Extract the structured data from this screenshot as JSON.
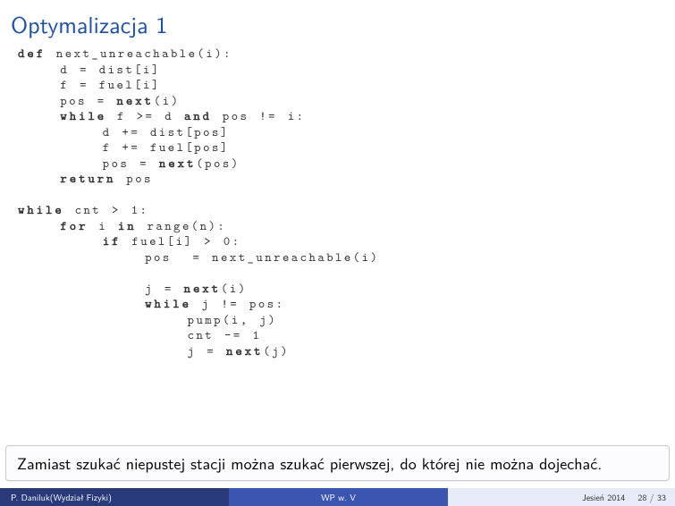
{
  "title": "Optymalizacja 1",
  "code_lines": [
    {
      "cls": "kw",
      "text": "def",
      "rest": " next_unreachable(i):"
    },
    {
      "cls": "",
      "text": "    d = dist[i]"
    },
    {
      "cls": "",
      "text": "    f = fuel[i]"
    },
    {
      "cls": "",
      "text": "    pos = ",
      "kw": "next",
      "rest2": "(i)"
    },
    {
      "cls": "",
      "pre": "    ",
      "kw": "while",
      "mid": " f >= d ",
      "kw2": "and",
      "rest": " pos != i:"
    },
    {
      "cls": "",
      "text": "        d += dist[pos]"
    },
    {
      "cls": "",
      "text": "        f += fuel[pos]"
    },
    {
      "cls": "",
      "text": "        pos = ",
      "kw": "next",
      "rest2": "(pos)"
    },
    {
      "cls": "",
      "pre": "    ",
      "kw": "return",
      "rest": " pos"
    },
    {
      "cls": "",
      "text": ""
    },
    {
      "cls": "kw",
      "text": "while",
      "rest": " cnt > 1:"
    },
    {
      "cls": "",
      "pre": "    ",
      "kw": "for",
      "mid": " i ",
      "kw2": "in",
      "rest": " range(n):"
    },
    {
      "cls": "",
      "pre": "        ",
      "kw": "if",
      "rest": " fuel[i] > 0:"
    },
    {
      "cls": "",
      "text": "            pos  = next_unreachable(i)"
    },
    {
      "cls": "",
      "text": ""
    },
    {
      "cls": "",
      "text": "            j = ",
      "kw": "next",
      "rest2": "(i)"
    },
    {
      "cls": "",
      "pre": "            ",
      "kw": "while",
      "rest": " j != pos:"
    },
    {
      "cls": "",
      "text": "                pump(i, j)"
    },
    {
      "cls": "",
      "text": "                cnt -= 1"
    },
    {
      "cls": "",
      "text": "                j = ",
      "kw": "next",
      "rest2": "(j)"
    }
  ],
  "note": "Zamiast szukać niepustej stacji można szukać pierwszej, do której nie można dojechać.",
  "footer": {
    "author": "P. Daniluk(Wydział Fizyki)",
    "middle": "WP w. V",
    "term": "Jesień 2014",
    "page": "28 / 33"
  }
}
